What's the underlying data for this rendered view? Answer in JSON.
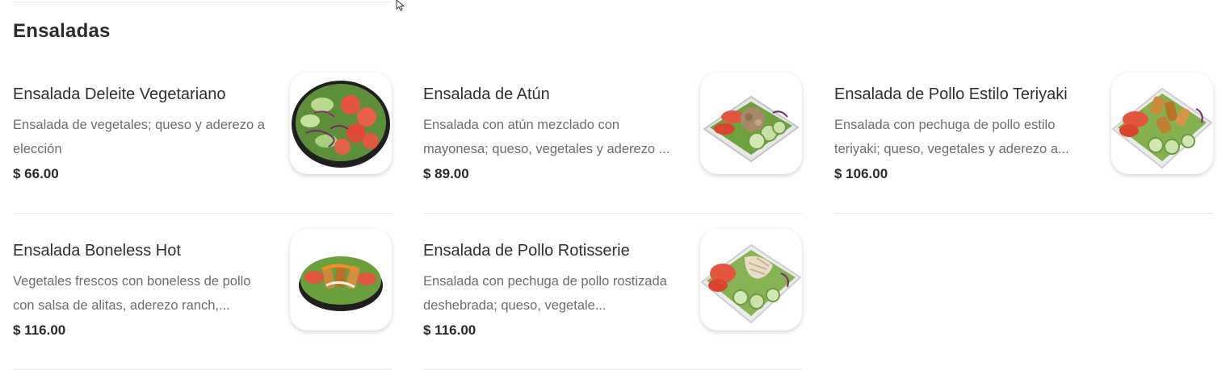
{
  "section": {
    "title": "Ensaladas"
  },
  "items": [
    {
      "name": "Ensalada Deleite Vegetariano",
      "description": "Ensalada de vegetales; queso y aderezo a elección",
      "price": "$ 66.00",
      "image": "vegetarian-salad-image"
    },
    {
      "name": "Ensalada de Atún",
      "description": "Ensalada con atún mezclado con mayonesa; queso, vegetales y aderezo ...",
      "price": "$ 89.00",
      "image": "tuna-salad-image"
    },
    {
      "name": "Ensalada de Pollo Estilo Teriyaki",
      "description": "Ensalada con pechuga de pollo estilo teriyaki; queso, vegetales y aderezo a...",
      "price": "$ 106.00",
      "image": "teriyaki-chicken-salad-image"
    },
    {
      "name": "Ensalada Boneless Hot",
      "description": "Vegetales frescos con boneless de pollo con salsa de alitas, aderezo ranch,...",
      "price": "$ 116.00",
      "image": "boneless-hot-salad-image"
    },
    {
      "name": "Ensalada de Pollo Rotisserie",
      "description": "Ensalada con pechuga de pollo rostizada deshebrada; queso, vegetale...",
      "price": "$ 116.00",
      "image": "rotisserie-chicken-salad-image"
    }
  ]
}
